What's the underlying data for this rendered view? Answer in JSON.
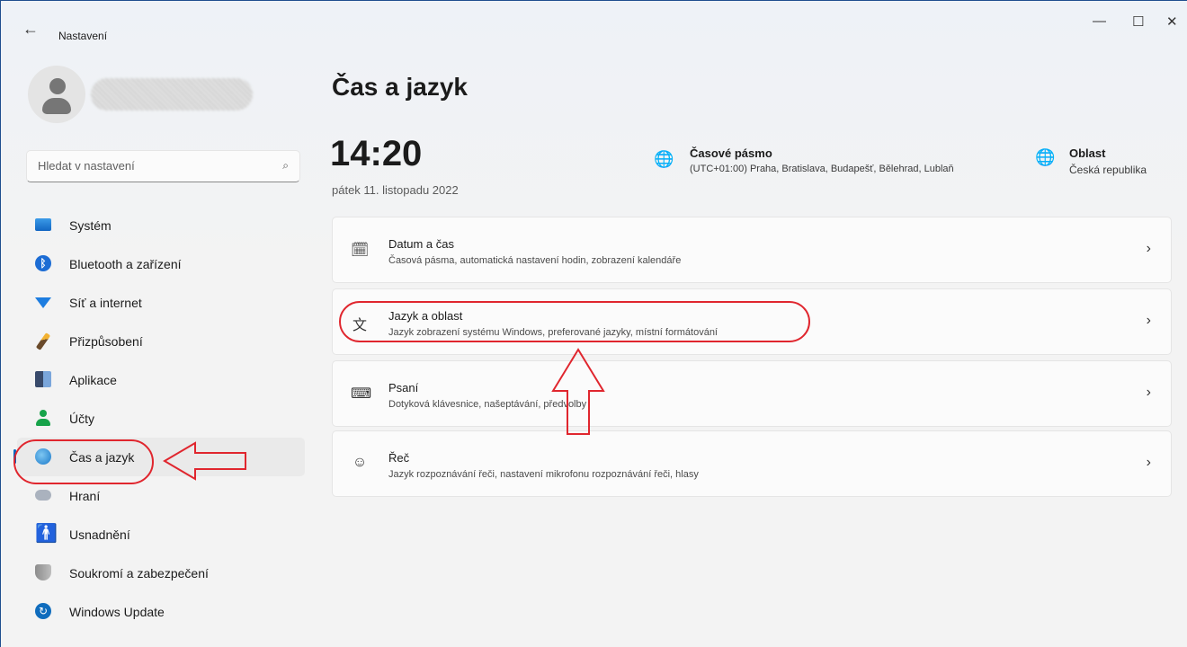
{
  "window": {
    "back_glyph": "←",
    "title": "Nastavení",
    "minimize_glyph": "—",
    "maximize_glyph": "☐",
    "close_glyph": "✕"
  },
  "search": {
    "placeholder": "Hledat v nastavení",
    "icon": "search-icon"
  },
  "sidebar": {
    "items": [
      {
        "label": "Systém",
        "icon": "system-icon"
      },
      {
        "label": "Bluetooth a zařízení",
        "icon": "bluetooth-icon"
      },
      {
        "label": "Síť a internet",
        "icon": "wifi-icon"
      },
      {
        "label": "Přizpůsobení",
        "icon": "brush-icon"
      },
      {
        "label": "Aplikace",
        "icon": "apps-icon"
      },
      {
        "label": "Účty",
        "icon": "accounts-icon"
      },
      {
        "label": "Čas a jazyk",
        "icon": "time-language-icon",
        "selected": true
      },
      {
        "label": "Hraní",
        "icon": "gaming-icon"
      },
      {
        "label": "Usnadnění",
        "icon": "accessibility-icon"
      },
      {
        "label": "Soukromí a zabezpečení",
        "icon": "shield-icon"
      },
      {
        "label": "Windows Update",
        "icon": "update-icon"
      }
    ]
  },
  "main": {
    "title": "Čas a jazyk",
    "clock": "14:20",
    "date": "pátek 11. listopadu 2022",
    "timezone": {
      "title": "Časové pásmo",
      "value": "(UTC+01:00) Praha, Bratislava, Budapešť, Bělehrad, Lublaň"
    },
    "region": {
      "title": "Oblast",
      "value": "Česká republika"
    },
    "cards": [
      {
        "title": "Datum a čas",
        "subtitle": "Časová pásma, automatická nastavení hodin, zobrazení kalendáře",
        "icon": "calendar-clock-icon"
      },
      {
        "title": "Jazyk a oblast",
        "subtitle": "Jazyk zobrazení systému Windows, preferované jazyky, místní formátování",
        "icon": "language-icon"
      },
      {
        "title": "Psaní",
        "subtitle": "Dotyková klávesnice, našeptávání, předvolby",
        "icon": "keyboard-icon"
      },
      {
        "title": "Řeč",
        "subtitle": "Jazyk rozpoznávání řeči, nastavení mikrofonu rozpoznávání řeči, hlasy",
        "icon": "speech-icon"
      }
    ],
    "chevron_glyph": "›"
  },
  "annotations": {
    "color": "#e0262e"
  }
}
